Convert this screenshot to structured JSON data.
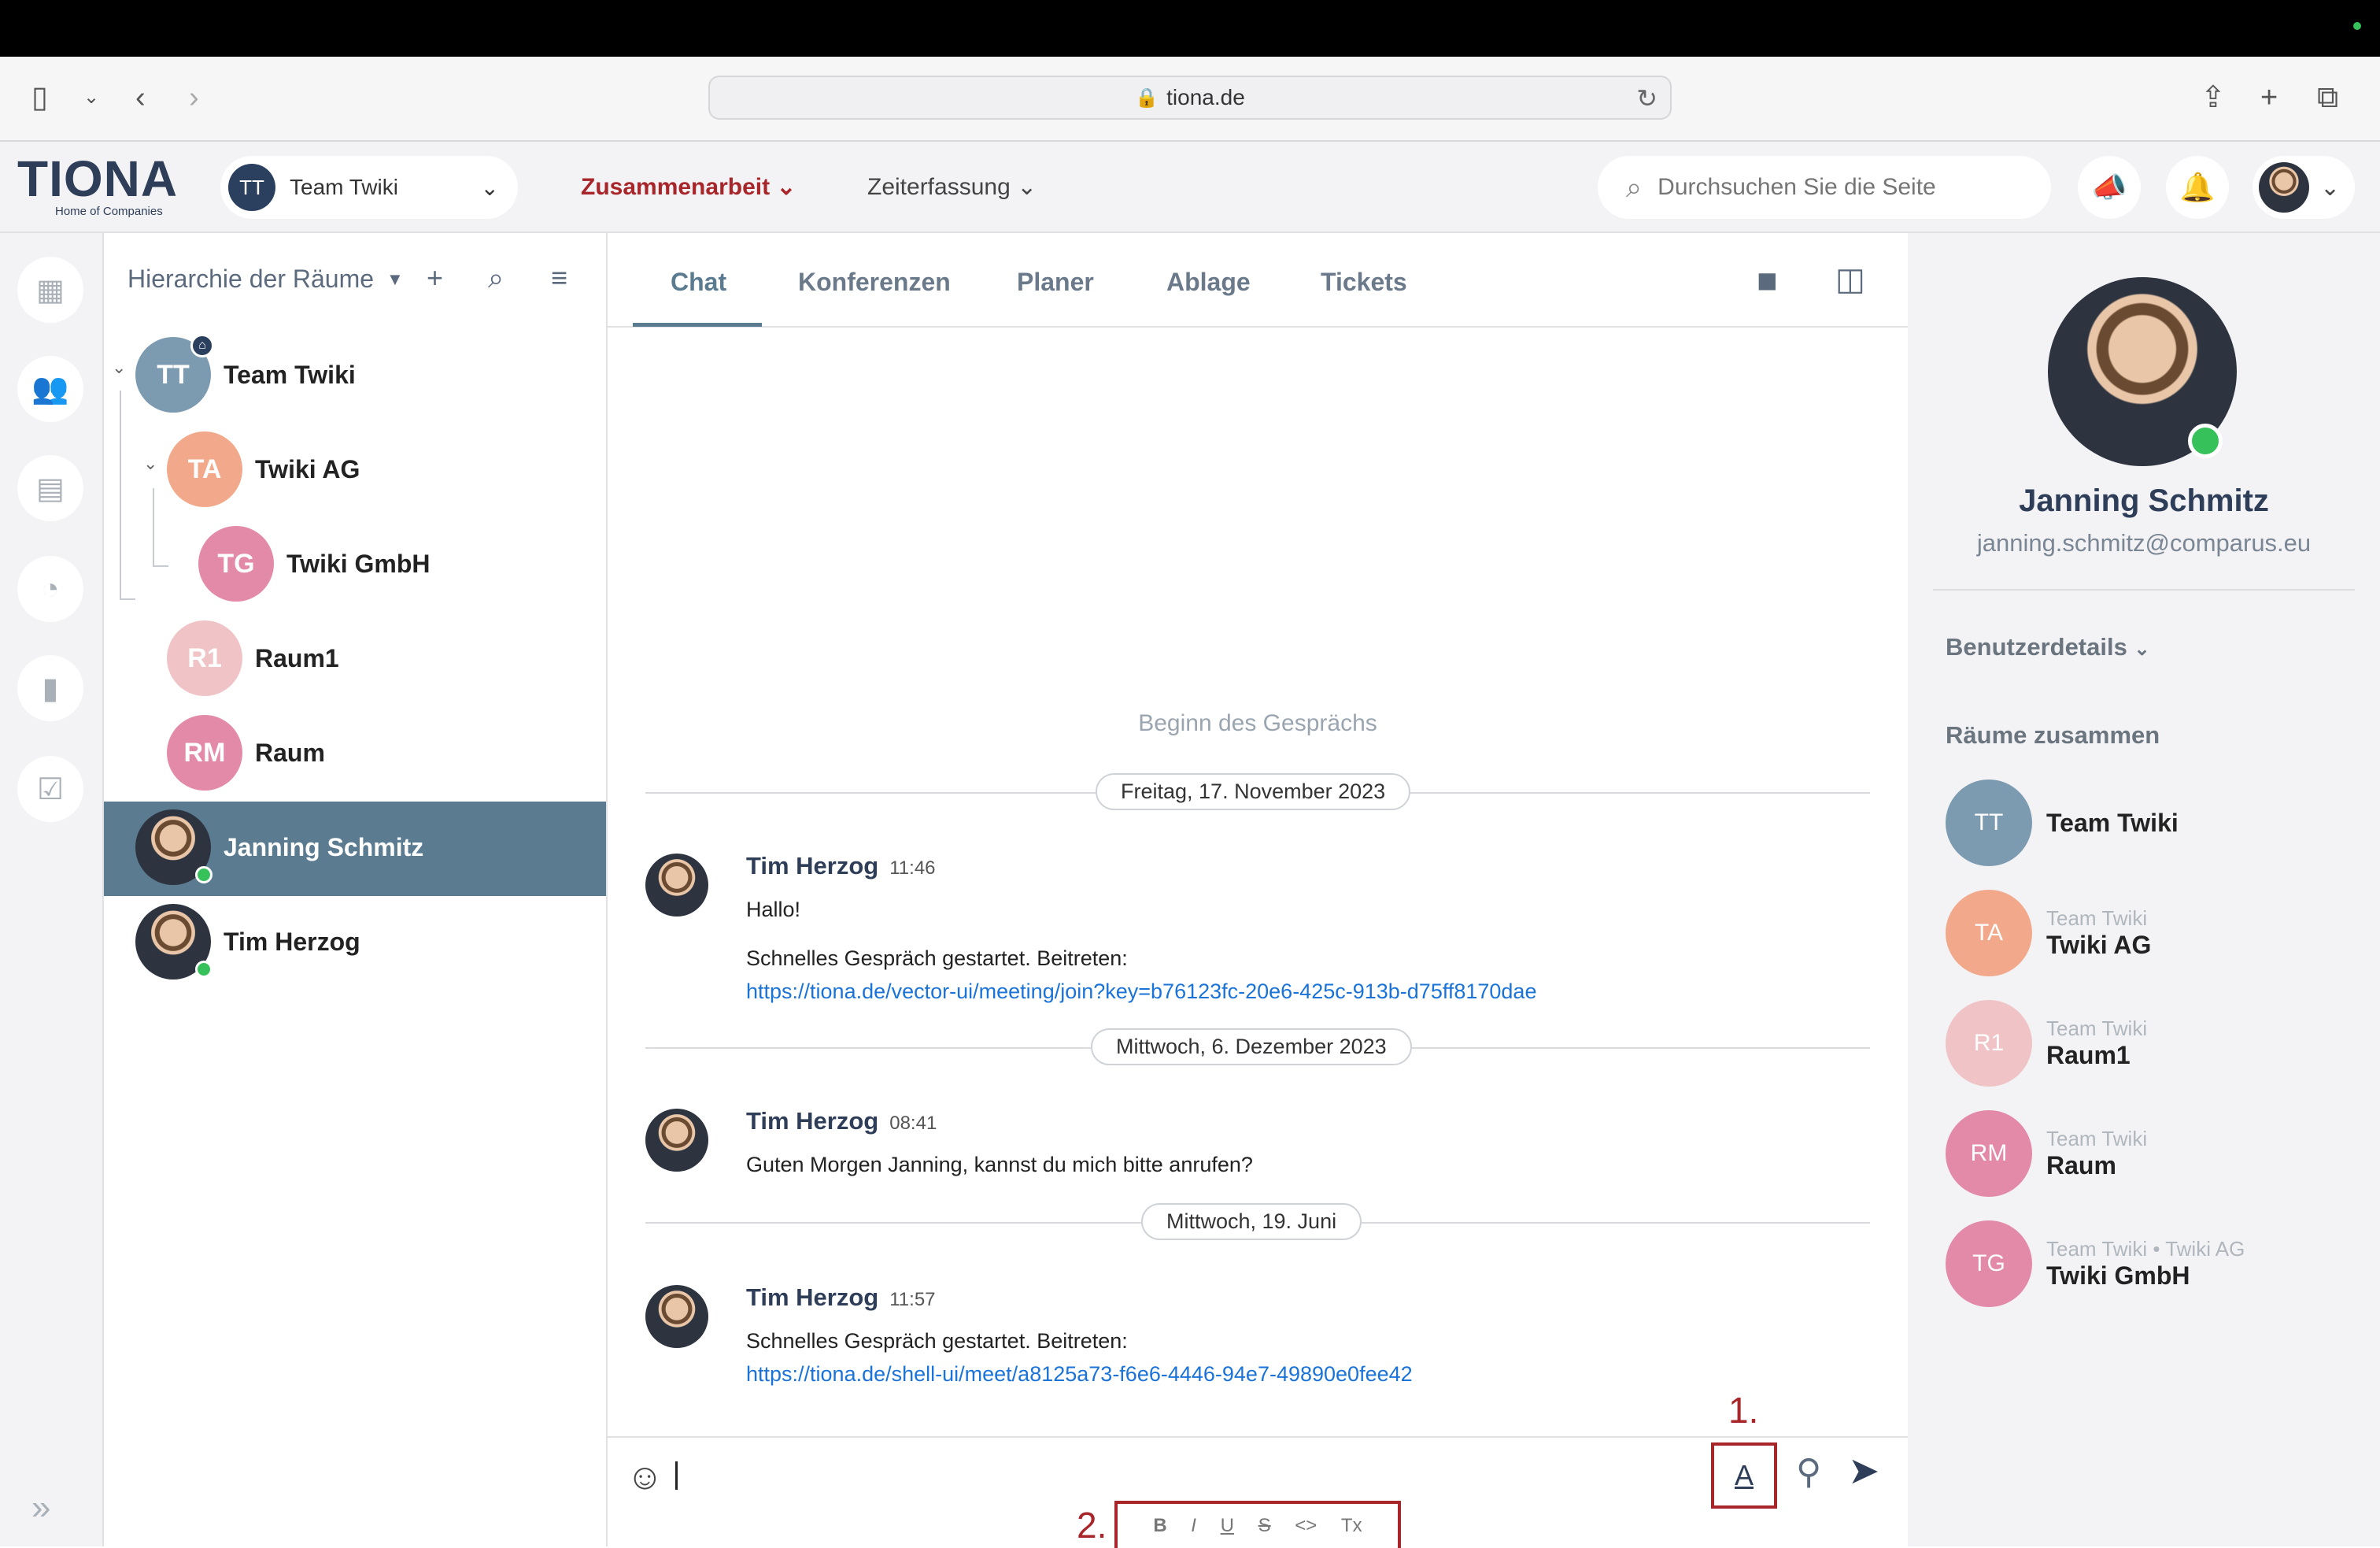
{
  "browser": {
    "url": "tiona.de"
  },
  "header": {
    "logo": "TIONA",
    "logo_sub": "Home of Companies",
    "team_selector": {
      "initials": "TT",
      "label": "Team Twiki"
    },
    "nav": [
      {
        "label": "Zusammenarbeit",
        "active": true
      },
      {
        "label": "Zeiterfassung",
        "active": false
      }
    ],
    "search_placeholder": "Durchsuchen Sie die Seite"
  },
  "tree": {
    "title": "Hierarchie der Räume",
    "items": [
      {
        "initials": "TT",
        "label": "Team Twiki",
        "color": "#7d9bb0"
      },
      {
        "initials": "TA",
        "label": "Twiki AG",
        "color": "#f2a98b"
      },
      {
        "initials": "TG",
        "label": "Twiki GmbH",
        "color": "#e38aa8"
      },
      {
        "initials": "R1",
        "label": "Raum1",
        "color": "#f0c4c6"
      },
      {
        "initials": "RM",
        "label": "Raum",
        "color": "#e38aa8"
      },
      {
        "label": "Janning Schmitz"
      },
      {
        "label": "Tim Herzog"
      }
    ]
  },
  "tabs": [
    "Chat",
    "Konferenzen",
    "Planer",
    "Ablage",
    "Tickets"
  ],
  "chat": {
    "begin": "Beginn des Gesprächs",
    "days": [
      "Freitag, 17. November 2023",
      "Mittwoch, 6. Dezember 2023",
      "Mittwoch, 19. Juni"
    ],
    "messages": [
      {
        "name": "Tim Herzog",
        "time": "11:46",
        "line1": "Hallo!",
        "line2": "Schnelles Gespräch gestartet. Beitreten:",
        "link": "https://tiona.de/vector-ui/meeting/join?key=b76123fc-20e6-425c-913b-d75ff8170dae"
      },
      {
        "name": "Tim Herzog",
        "time": "08:41",
        "line1": "Guten Morgen Janning, kannst du mich bitte anrufen?"
      },
      {
        "name": "Tim Herzog",
        "time": "11:57",
        "line1": "Schnelles Gespräch gestartet. Beitreten:",
        "link": "https://tiona.de/shell-ui/meet/a8125a73-f6e6-4446-94e7-49890e0fee42"
      }
    ],
    "annotations": [
      "1.",
      "2."
    ],
    "format_buttons": [
      "B",
      "I",
      "U",
      "S",
      "<>",
      "Tx"
    ]
  },
  "profile": {
    "name": "Janning Schmitz",
    "email": "janning.schmitz@comparus.eu",
    "details_label": "Benutzerdetails",
    "rooms_label": "Räume zusammen",
    "rooms": [
      {
        "initials": "TT",
        "sub": "",
        "name": "Team Twiki",
        "color": "#7d9bb0"
      },
      {
        "initials": "TA",
        "sub": "Team Twiki",
        "name": "Twiki AG",
        "color": "#f2a98b"
      },
      {
        "initials": "R1",
        "sub": "Team Twiki",
        "name": "Raum1",
        "color": "#f0c4c6"
      },
      {
        "initials": "RM",
        "sub": "Team Twiki",
        "name": "Raum",
        "color": "#e38aa8"
      },
      {
        "initials": "TG",
        "sub": "Team Twiki • Twiki AG",
        "name": "Twiki GmbH",
        "color": "#e38aa8"
      }
    ]
  }
}
